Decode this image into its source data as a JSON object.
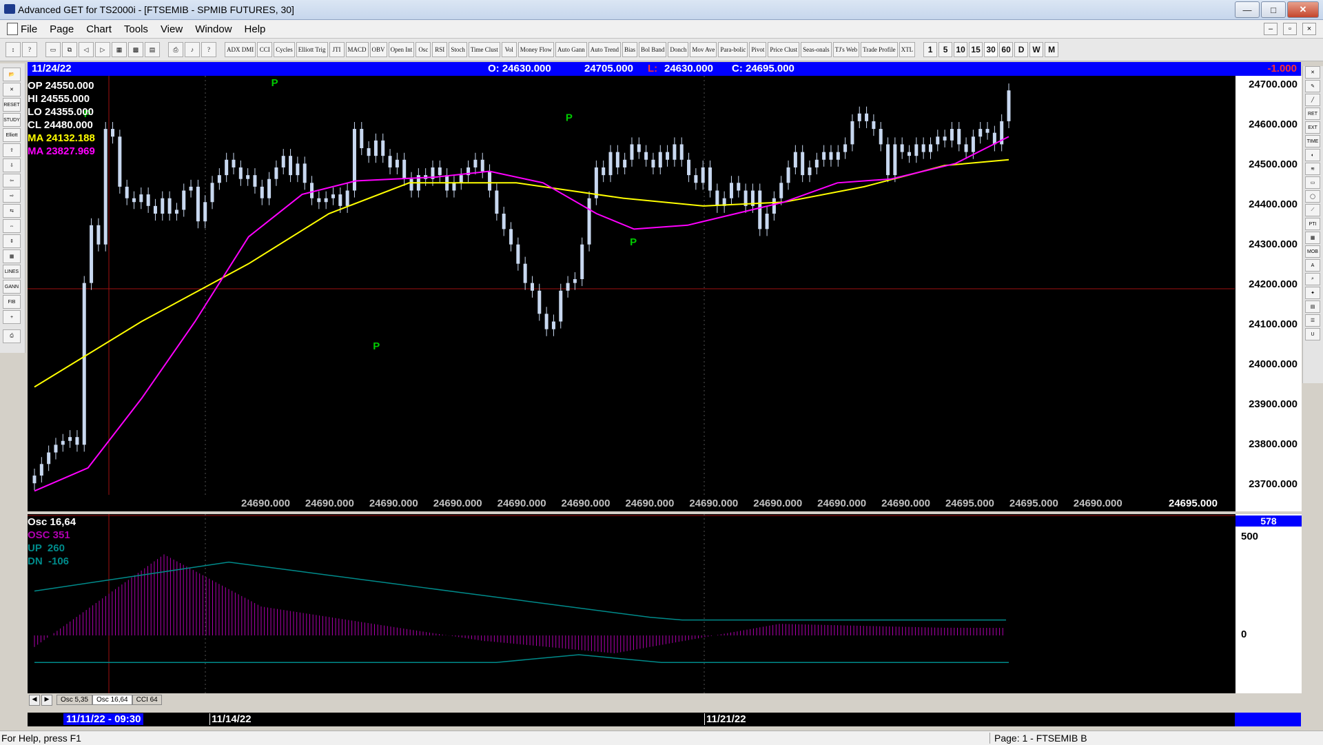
{
  "window": {
    "title": "Advanced GET for TS2000i - [FTSEMIB - SPMIB FUTURES, 30]",
    "minimize": "—",
    "maximize": "□",
    "close": "✕"
  },
  "menu": {
    "items": [
      "File",
      "Page",
      "Chart",
      "Tools",
      "View",
      "Window",
      "Help"
    ]
  },
  "toolbar": {
    "study_buttons": [
      "ADX DMI",
      "CCI",
      "Cycles",
      "Elliott Trig",
      "JTI",
      "MACD",
      "OBV",
      "Open Int",
      "Osc",
      "RSI",
      "Stoch",
      "Time Clust",
      "Vol",
      "Money Flow",
      "Auto Gann",
      "Auto Trend",
      "Bias",
      "Bol Band",
      "Donch",
      "Mov Ave",
      "Para-bolic",
      "Pivot",
      "Price Clust",
      "Seas-onals",
      "TJ's Web",
      "Trade Profile",
      "XTL"
    ],
    "intervals": [
      "1",
      "5",
      "10",
      "15",
      "30",
      "60",
      "D",
      "W",
      "M"
    ],
    "active_interval": "30"
  },
  "info_bar": {
    "date": "11/24/22",
    "open": "O: 24630.000",
    "high": "24705.000",
    "low_label": "L:",
    "low": "24630.000",
    "close": "C: 24695.000",
    "change": "-1.000"
  },
  "legend": {
    "op": {
      "label": "OP",
      "value": "24550.000"
    },
    "hi": {
      "label": "HI",
      "value": "24555.000"
    },
    "lo": {
      "label": "LO",
      "value": "24355.000"
    },
    "cl": {
      "label": "CL",
      "value": "24480.000"
    },
    "ma1": {
      "label": "MA",
      "value": "24132.188"
    },
    "ma2": {
      "label": "MA",
      "value": "23827.969"
    }
  },
  "price_axis": {
    "ticks": [
      "24700.000",
      "24600.000",
      "24500.000",
      "24400.000",
      "24300.000",
      "24200.000",
      "24100.000",
      "24000.000",
      "23900.000",
      "23800.000",
      "23700.000"
    ]
  },
  "bottom_values": [
    "24690.000",
    "24690.000",
    "24690.000",
    "24690.000",
    "24690.000",
    "24690.000",
    "24690.000",
    "24690.000",
    "24690.000",
    "24690.000",
    "24690.000",
    "24695.000",
    "24695.000",
    "24690.000"
  ],
  "last_price": "24695.000",
  "pivot_label": "P",
  "osc": {
    "title": "Osc 16,64",
    "osc": "OSC 351",
    "up": "UP  260",
    "dn": "DN  -106",
    "top_value": "578",
    "tick_500": "500",
    "tick_0": "0"
  },
  "osc_tabs": [
    "Osc 5,35",
    "Osc 16,64",
    "CCI 64"
  ],
  "dates": {
    "first": "11/11/22 - 09:30",
    "second": "11/14/22",
    "third": "11/21/22"
  },
  "status": {
    "help": "For Help, press F1",
    "page": "Page: 1 - FTSEMIB B"
  },
  "colors": {
    "ma_fast": "#ffff00",
    "ma_slow": "#ff00ff",
    "candle": "#c8d8f0",
    "pivot": "#00cc00",
    "osc_hist": "#b000b0",
    "osc_line": "#008b8b",
    "info_bar": "#0000ff"
  },
  "chart_data": {
    "type": "candlestick",
    "ylim": [
      23650,
      24720
    ],
    "closes": [
      23700,
      23730,
      23760,
      23780,
      23790,
      23800,
      23780,
      24200,
      24350,
      24300,
      24600,
      24580,
      24450,
      24420,
      24410,
      24430,
      24400,
      24380,
      24420,
      24380,
      24390,
      24440,
      24450,
      24360,
      24410,
      24460,
      24480,
      24520,
      24500,
      24470,
      24480,
      24450,
      24420,
      24470,
      24500,
      24530,
      24480,
      24510,
      24460,
      24420,
      24410,
      24420,
      24430,
      24400,
      24440,
      24600,
      24550,
      24530,
      24570,
      24530,
      24500,
      24520,
      24470,
      24440,
      24480,
      24470,
      24500,
      24480,
      24440,
      24460,
      24480,
      24500,
      24520,
      24490,
      24440,
      24380,
      24340,
      24300,
      24250,
      24200,
      24180,
      24120,
      24080,
      24100,
      24180,
      24200,
      24210,
      24300,
      24420,
      24500,
      24480,
      24540,
      24500,
      24520,
      24560,
      24540,
      24520,
      24500,
      24540,
      24520,
      24560,
      24520,
      24480,
      24460,
      24500,
      24440,
      24400,
      24420,
      24460,
      24440,
      24400,
      24440,
      24340,
      24380,
      24420,
      24460,
      24500,
      24540,
      24480,
      24500,
      24520,
      24540,
      24520,
      24540,
      24560,
      24620,
      24640,
      24620,
      24600,
      24560,
      24480,
      24560,
      24540,
      24530,
      24560,
      24540,
      24560,
      24580,
      24570,
      24600,
      24560,
      24540,
      24580,
      24600,
      24590,
      24560,
      24620,
      24700
    ],
    "ma_fast": [
      [
        0,
        23930
      ],
      [
        20,
        24100
      ],
      [
        40,
        24250
      ],
      [
        55,
        24380
      ],
      [
        70,
        24460
      ],
      [
        90,
        24460
      ],
      [
        110,
        24420
      ],
      [
        125,
        24400
      ],
      [
        140,
        24410
      ],
      [
        155,
        24450
      ],
      [
        170,
        24505
      ],
      [
        182,
        24520
      ]
    ],
    "ma_slow": [
      [
        0,
        23660
      ],
      [
        10,
        23720
      ],
      [
        20,
        23900
      ],
      [
        30,
        24100
      ],
      [
        40,
        24320
      ],
      [
        50,
        24430
      ],
      [
        60,
        24465
      ],
      [
        75,
        24475
      ],
      [
        85,
        24490
      ],
      [
        95,
        24460
      ],
      [
        105,
        24380
      ],
      [
        112,
        24340
      ],
      [
        122,
        24350
      ],
      [
        140,
        24410
      ],
      [
        150,
        24460
      ],
      [
        160,
        24470
      ],
      [
        172,
        24510
      ],
      [
        182,
        24580
      ]
    ],
    "pivots": [
      {
        "i": 10,
        "price": 24620,
        "dir": "high"
      },
      {
        "i": 45,
        "price": 24700,
        "dir": "high"
      },
      {
        "i": 64,
        "price": 24060,
        "dir": "low"
      },
      {
        "i": 100,
        "price": 24610,
        "dir": "high"
      },
      {
        "i": 112,
        "price": 24330,
        "dir": "low"
      }
    ],
    "hline": 24185
  }
}
